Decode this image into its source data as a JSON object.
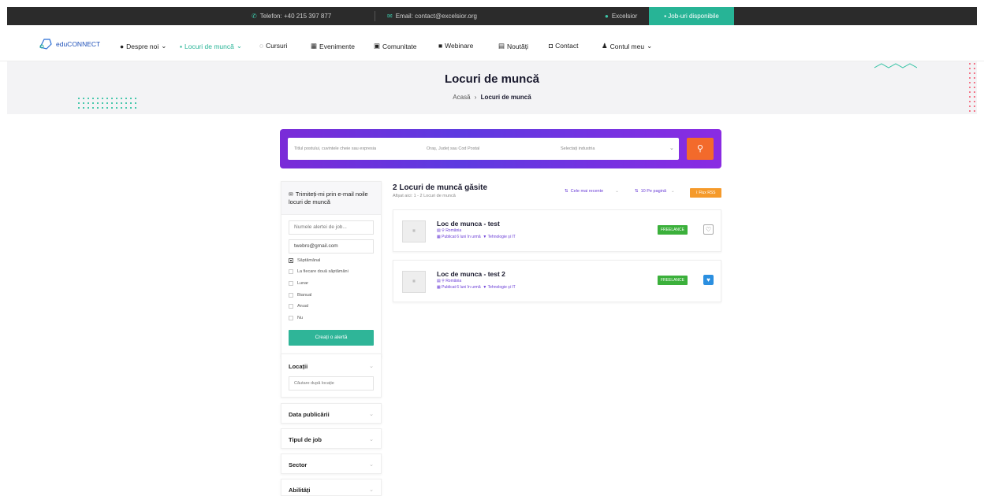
{
  "topbar": {
    "phone": "Telefon: +40 215 397 877",
    "email": "Email: contact@excelsior.org",
    "user": "Excelsior",
    "jobs_button": "Job-uri disponibile"
  },
  "nav": {
    "logo": "eduCONNECT",
    "items": [
      "Despre noi",
      "Locuri de muncă",
      "Cursuri",
      "Evenimente",
      "Comunitate",
      "Webinare",
      "Noutăți",
      "Contact",
      "Contul meu"
    ]
  },
  "hero": {
    "title": "Locuri de muncă",
    "breadcrumb_home": "Acasă",
    "breadcrumb_sep": "›",
    "breadcrumb_current": "Locuri de muncă"
  },
  "search": {
    "keywords_placeholder": "Titlul postului, cuvintele cheie sau expresia",
    "location_placeholder": "Oraș, Județ sau Cod Postal",
    "industry_placeholder": "Selectați industria"
  },
  "alert": {
    "title": "Trimiteți-mi prin e-mail noile locuri de muncă",
    "name_placeholder": "Numele alertei de job...",
    "email_value": "twebro@gmail.com",
    "frequencies": [
      "Săptămânal",
      "La fiecare două săptămâni",
      "Lunar",
      "Bianual",
      "Anual",
      "Nu"
    ],
    "selected_frequency": "Săptămânal",
    "create_button": "Creați o alertă"
  },
  "filters": {
    "location_title": "Locații",
    "location_placeholder": "Căutare după locație",
    "date_title": "Data publicării",
    "type_title": "Tipul de job",
    "sector_title": "Sector",
    "skills_title": "Abilități"
  },
  "results": {
    "title": "2 Locuri de muncă găsite",
    "subtitle": "Afișat aici: 1 - 2 Locuri de muncă",
    "sort_label": "Cele mai recente",
    "per_page_label": "10 Pe pagină",
    "rss_label": "Flux RSS"
  },
  "jobs": [
    {
      "title": "Loc de munca - test",
      "location": "România",
      "published": "Publicat 6 luni în urmă",
      "category": "Tehnologie și IT",
      "type": "FREELANCE",
      "favorited": false
    },
    {
      "title": "Loc de munca - test 2",
      "location": "România",
      "published": "Publicat 6 luni în urmă",
      "category": "Tehnologie și IT",
      "type": "FREELANCE",
      "favorited": true
    }
  ],
  "colors": {
    "accent": "#27b496",
    "purple": "#6a3cd6",
    "orange": "#f36a2b",
    "dark": "#2b2b2b"
  }
}
